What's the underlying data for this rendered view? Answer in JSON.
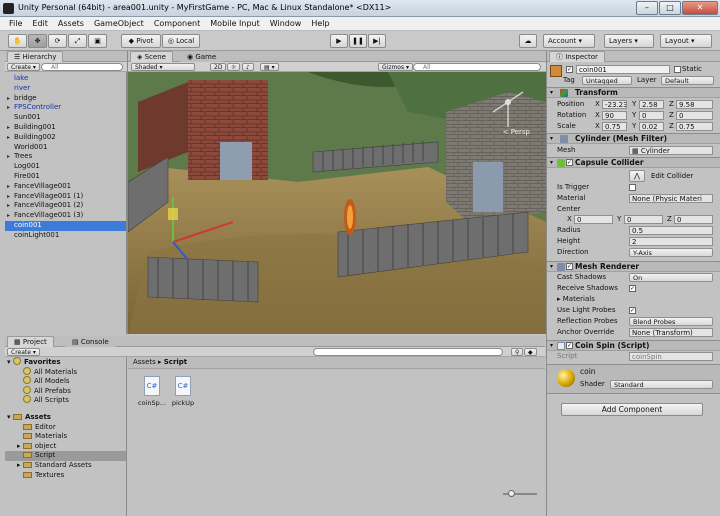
{
  "window": {
    "title": "Unity Personal (64bit) - area001.unity - MyFirstGame - PC, Mac & Linux Standalone* <DX11>",
    "minimize": "–",
    "maximize": "□",
    "close": "✕"
  },
  "menu": [
    "File",
    "Edit",
    "Assets",
    "GameObject",
    "Component",
    "Mobile Input",
    "Window",
    "Help"
  ],
  "toolbar": {
    "pivot": "Pivot",
    "local": "Local",
    "account": "Account",
    "layers": "Layers",
    "layout": "Layout"
  },
  "hierarchy": {
    "tab": "Hierarchy",
    "create": "Create",
    "search_placeholder": "All",
    "items": [
      {
        "label": "lake",
        "blue": true,
        "arrow": false
      },
      {
        "label": "river",
        "blue": true,
        "arrow": false
      },
      {
        "label": "bridge",
        "blue": false,
        "arrow": true
      },
      {
        "label": "FPSController",
        "blue": true,
        "arrow": true
      },
      {
        "label": "Sun001",
        "blue": false,
        "arrow": false
      },
      {
        "label": "Building001",
        "blue": false,
        "arrow": true
      },
      {
        "label": "Building002",
        "blue": false,
        "arrow": true
      },
      {
        "label": "World001",
        "blue": false,
        "arrow": false
      },
      {
        "label": "Trees",
        "blue": false,
        "arrow": true
      },
      {
        "label": "Log001",
        "blue": false,
        "arrow": false
      },
      {
        "label": "Fire001",
        "blue": false,
        "arrow": false
      },
      {
        "label": "FanceVillage001",
        "blue": false,
        "arrow": true
      },
      {
        "label": "FanceVillage001 (1)",
        "blue": false,
        "arrow": true
      },
      {
        "label": "FanceVillage001 (2)",
        "blue": false,
        "arrow": true
      },
      {
        "label": "FanceVillage001 (3)",
        "blue": false,
        "arrow": true
      },
      {
        "label": "coin001",
        "blue": false,
        "arrow": false,
        "selected": true
      },
      {
        "label": "coinLight001",
        "blue": false,
        "arrow": false
      }
    ]
  },
  "scene": {
    "tab_scene": "Scene",
    "tab_game": "Game",
    "shading": "Shaded",
    "mode_2d": "2D",
    "gizmos": "Gizmos",
    "search_placeholder": "All",
    "persp": "< Persp"
  },
  "project": {
    "tab_project": "Project",
    "tab_console": "Console",
    "create": "Create",
    "breadcrumb": [
      "Assets",
      "Script"
    ],
    "favorites": {
      "label": "Favorites",
      "items": [
        "All Materials",
        "All Models",
        "All Prefabs",
        "All Scripts"
      ]
    },
    "assets": {
      "label": "Assets",
      "items": [
        {
          "label": "Editor",
          "sel": false
        },
        {
          "label": "Materials",
          "sel": false
        },
        {
          "label": "object",
          "sel": false
        },
        {
          "label": "Script",
          "sel": true
        },
        {
          "label": "Standard Assets",
          "sel": false
        },
        {
          "label": "Textures",
          "sel": false
        }
      ]
    },
    "files": [
      "coinSp...",
      "pickUp"
    ]
  },
  "inspector": {
    "tab": "Inspector",
    "object_name": "coin001",
    "static": "Static",
    "tag_label": "Tag",
    "tag": "Untagged",
    "layer_label": "Layer",
    "layer": "Default",
    "transform": {
      "title": "Transform",
      "rows": [
        {
          "label": "Position",
          "x": "-23.237",
          "y": "2.58",
          "z": "9.58"
        },
        {
          "label": "Rotation",
          "x": "90",
          "y": "0",
          "z": "0"
        },
        {
          "label": "Scale",
          "x": "0.75",
          "y": "0.02",
          "z": "0.75"
        }
      ]
    },
    "mesh_filter": {
      "title": "Cylinder (Mesh Filter)",
      "mesh_label": "Mesh",
      "mesh": "Cylinder"
    },
    "collider": {
      "title": "Capsule Collider",
      "edit": "Edit Collider",
      "is_trigger": "Is Trigger",
      "material_label": "Material",
      "material": "None (Physic Materi",
      "center": "Center",
      "cx": "0",
      "cy": "0",
      "cz": "0",
      "radius_label": "Radius",
      "radius": "0.5",
      "height_label": "Height",
      "height": "2",
      "direction_label": "Direction",
      "direction": "Y-Axis"
    },
    "renderer": {
      "title": "Mesh Renderer",
      "cast_label": "Cast Shadows",
      "cast": "On",
      "receive_label": "Receive Shadows",
      "materials": "Materials",
      "probes_label": "Use Light Probes",
      "reflection_label": "Reflection Probes",
      "reflection": "Blend Probes",
      "anchor_label": "Anchor Override",
      "anchor": "None (Transform)"
    },
    "script": {
      "title": "Coin Spin (Script)",
      "script_label": "Script",
      "script": "coinSpin"
    },
    "material": {
      "name": "coin",
      "shader_label": "Shader",
      "shader": "Standard"
    },
    "add_component": "Add Component"
  }
}
